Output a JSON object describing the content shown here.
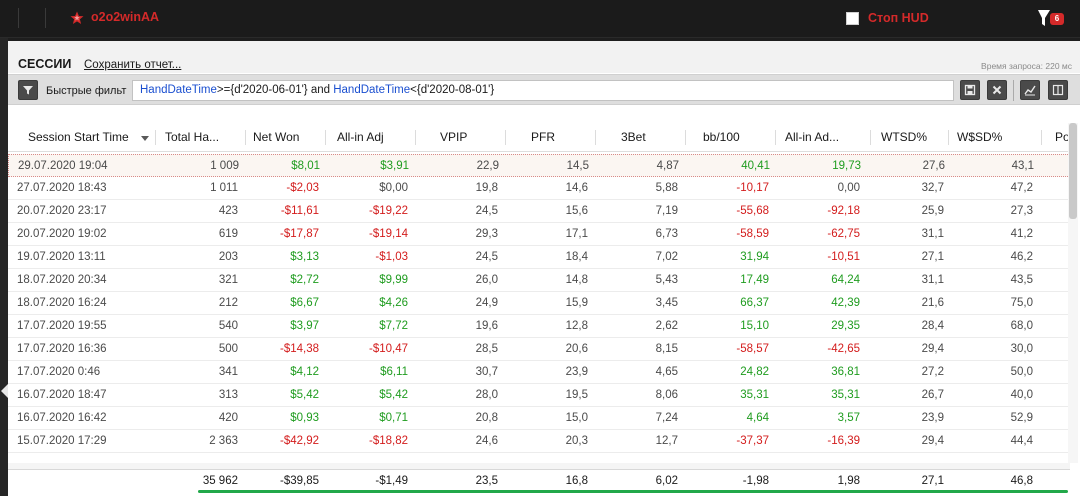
{
  "topbar": {
    "player_name": "o2o2winAA",
    "hud_label": "Стоп HUD",
    "notification_count": "6",
    "brand_color": "#d42a2a"
  },
  "panel": {
    "title": "СЕССИИ",
    "save_report_label": "Сохранить отчет...",
    "query_time": "Время запроса: 220 мс"
  },
  "filter": {
    "label": "Быстрые фильт",
    "expression_parts": [
      "HandDateTime",
      ">=",
      "{d'2020-06-01'}",
      " and ",
      "HandDateTime",
      "<",
      "{d'2020-08-01'}"
    ]
  },
  "table": {
    "columns": [
      "Session Start Time",
      "Total Ha...",
      "Net Won",
      "All-in Adj",
      "VPIP",
      "PFR",
      "3Bet",
      "bb/100",
      "All-in Ad...",
      "WTSD%",
      "W$SD%",
      "Po"
    ],
    "rows": [
      [
        "29.07.2020 19:04",
        "1 009",
        "$8,01",
        "$3,91",
        "22,9",
        "14,5",
        "4,87",
        "40,41",
        "19,73",
        "27,6",
        "43,1"
      ],
      [
        "27.07.2020 18:43",
        "1 011",
        "-$2,03",
        "$0,00",
        "19,8",
        "14,6",
        "5,88",
        "-10,17",
        "0,00",
        "32,7",
        "47,2"
      ],
      [
        "20.07.2020 23:17",
        "423",
        "-$11,61",
        "-$19,22",
        "24,5",
        "15,6",
        "7,19",
        "-55,68",
        "-92,18",
        "25,9",
        "27,3"
      ],
      [
        "20.07.2020 19:02",
        "619",
        "-$17,87",
        "-$19,14",
        "29,3",
        "17,1",
        "6,73",
        "-58,59",
        "-62,75",
        "31,1",
        "41,2"
      ],
      [
        "19.07.2020 13:11",
        "203",
        "$3,13",
        "-$1,03",
        "24,5",
        "18,4",
        "7,02",
        "31,94",
        "-10,51",
        "27,1",
        "46,2"
      ],
      [
        "18.07.2020 20:34",
        "321",
        "$2,72",
        "$9,99",
        "26,0",
        "14,8",
        "5,43",
        "17,49",
        "64,24",
        "31,1",
        "43,5"
      ],
      [
        "18.07.2020 16:24",
        "212",
        "$6,67",
        "$4,26",
        "24,9",
        "15,9",
        "3,45",
        "66,37",
        "42,39",
        "21,6",
        "75,0"
      ],
      [
        "17.07.2020 19:55",
        "540",
        "$3,97",
        "$7,72",
        "19,6",
        "12,8",
        "2,62",
        "15,10",
        "29,35",
        "28,4",
        "68,0"
      ],
      [
        "17.07.2020 16:36",
        "500",
        "-$14,38",
        "-$10,47",
        "28,5",
        "20,6",
        "8,15",
        "-58,57",
        "-42,65",
        "29,4",
        "30,0"
      ],
      [
        "17.07.2020 0:46",
        "341",
        "$4,12",
        "$6,11",
        "30,7",
        "23,9",
        "4,65",
        "24,82",
        "36,81",
        "27,2",
        "50,0"
      ],
      [
        "16.07.2020 18:47",
        "313",
        "$5,42",
        "$5,42",
        "28,0",
        "19,5",
        "8,06",
        "35,31",
        "35,31",
        "26,7",
        "40,0"
      ],
      [
        "16.07.2020 16:42",
        "420",
        "$0,93",
        "$0,71",
        "20,8",
        "15,0",
        "7,24",
        "4,64",
        "3,57",
        "23,9",
        "52,9"
      ],
      [
        "15.07.2020 17:29",
        "2 363",
        "-$42,92",
        "-$18,82",
        "24,6",
        "20,3",
        "12,7",
        "-37,37",
        "-16,39",
        "29,4",
        "44,4"
      ]
    ],
    "totals": [
      "35 962",
      "-$39,85",
      "-$1,49",
      "23,5",
      "16,8",
      "6,02",
      "-1,98",
      "1,98",
      "27,1",
      "46,8"
    ]
  },
  "colors": {
    "positive": "#1f9c1f",
    "negative": "#d31c1c",
    "accent_bar": "#22a84a"
  }
}
